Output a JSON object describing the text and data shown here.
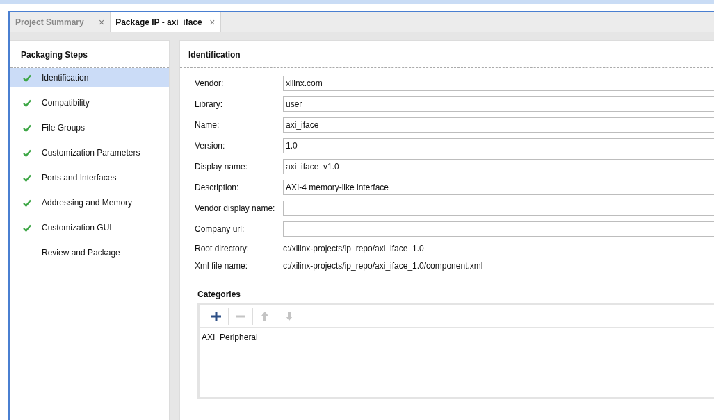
{
  "tabs": [
    {
      "label": "Project Summary",
      "close": "×",
      "selected": false
    },
    {
      "label": "Package IP - axi_iface",
      "close": "×",
      "selected": true
    }
  ],
  "steps_panel": {
    "title": "Packaging Steps",
    "items": [
      {
        "label": "Identification",
        "done": true,
        "selected": true
      },
      {
        "label": "Compatibility",
        "done": true,
        "selected": false
      },
      {
        "label": "File Groups",
        "done": true,
        "selected": false
      },
      {
        "label": "Customization Parameters",
        "done": true,
        "selected": false
      },
      {
        "label": "Ports and Interfaces",
        "done": true,
        "selected": false
      },
      {
        "label": "Addressing and Memory",
        "done": true,
        "selected": false
      },
      {
        "label": "Customization GUI",
        "done": true,
        "selected": false
      },
      {
        "label": "Review and Package",
        "done": false,
        "selected": false
      }
    ]
  },
  "identification": {
    "title": "Identification",
    "fields": [
      {
        "kind": "input",
        "label": "Vendor:",
        "value": "xilinx.com"
      },
      {
        "kind": "input",
        "label": "Library:",
        "value": "user"
      },
      {
        "kind": "input",
        "label": "Name:",
        "value": "axi_iface"
      },
      {
        "kind": "input",
        "label": "Version:",
        "value": "1.0"
      },
      {
        "kind": "input",
        "label": "Display name:",
        "value": "axi_iface_v1.0"
      },
      {
        "kind": "input",
        "label": "Description:",
        "value": "AXI-4 memory-like interface"
      },
      {
        "kind": "input",
        "label": "Vendor display name:"
      },
      {
        "kind": "input",
        "label": "Company url:"
      },
      {
        "kind": "text",
        "label": "Root directory:",
        "value": "c:/xilinx-projects/ip_repo/axi_iface_1.0"
      },
      {
        "kind": "text",
        "label": "Xml file name:",
        "value": "c:/xilinx-projects/ip_repo/axi_iface_1.0/component.xml"
      }
    ],
    "categories": {
      "title": "Categories",
      "toolbar": [
        {
          "kind": "add",
          "disabled": false
        },
        {
          "kind": "remove",
          "disabled": true
        },
        {
          "kind": "up",
          "disabled": true
        },
        {
          "kind": "down",
          "disabled": true
        }
      ],
      "items": [
        "AXI_Peripheral"
      ]
    }
  }
}
